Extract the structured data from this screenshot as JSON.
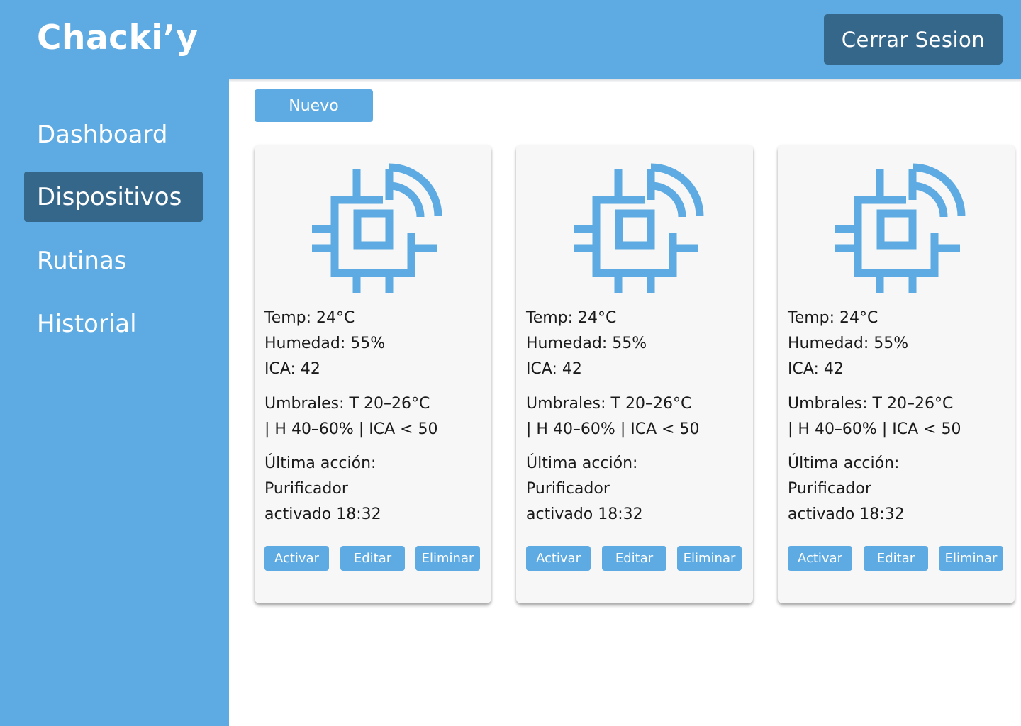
{
  "brand": "Chacki’y",
  "header": {
    "logout_label": "Cerrar Sesion"
  },
  "sidebar": {
    "items": [
      {
        "label": "Dashboard"
      },
      {
        "label": "Dispositivos"
      },
      {
        "label": "Rutinas"
      },
      {
        "label": "Historial"
      }
    ]
  },
  "main": {
    "new_label": "Nuevo",
    "cards": [
      {
        "temp": "Temp: 24°C",
        "humidity": "Humedad: 55%",
        "ica": "ICA: 42",
        "thresholds_1": "Umbrales: T 20–26°C",
        "thresholds_2": "| H 40–60% | ICA < 50",
        "last_action_1": "Última acción:",
        "last_action_2": "Purificador",
        "last_action_3": "activado 18:32",
        "activate_label": "Activar",
        "edit_label": "Editar",
        "delete_label": "Eliminar"
      },
      {
        "temp": "Temp: 24°C",
        "humidity": "Humedad: 55%",
        "ica": "ICA: 42",
        "thresholds_1": "Umbrales: T 20–26°C",
        "thresholds_2": "| H 40–60% | ICA < 50",
        "last_action_1": "Última acción:",
        "last_action_2": "Purificador",
        "last_action_3": "activado 18:32",
        "activate_label": "Activar",
        "edit_label": "Editar",
        "delete_label": "Eliminar"
      },
      {
        "temp": "Temp: 24°C",
        "humidity": "Humedad: 55%",
        "ica": "ICA: 42",
        "thresholds_1": "Umbrales: T 20–26°C",
        "thresholds_2": "| H 40–60% | ICA < 50",
        "last_action_1": "Última acción:",
        "last_action_2": "Purificador",
        "last_action_3": "activado 18:32",
        "activate_label": "Activar",
        "edit_label": "Editar",
        "delete_label": "Eliminar"
      }
    ]
  },
  "icons": {
    "device": "iot-chip-wireless-icon"
  },
  "colors": {
    "primary": "#5dabe2",
    "accent_dark": "#35678b",
    "card_bg": "#f7f7f7"
  }
}
